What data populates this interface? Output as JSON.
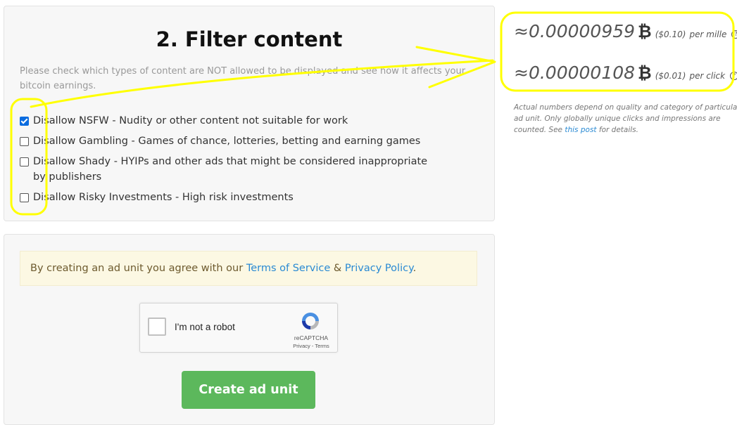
{
  "filter": {
    "title": "2. Filter content",
    "description": "Please check which types of content are NOT allowed to be displayed and see how it affects your bitcoin earnings.",
    "options": [
      {
        "label": "Disallow NSFW - Nudity or other content not suitable for work",
        "checked": true
      },
      {
        "label": "Disallow Gambling - Games of chance, lotteries, betting and earning games",
        "checked": false
      },
      {
        "label": "Disallow Shady - HYIPs and other ads that might be considered inappropriate by publishers",
        "checked": false
      },
      {
        "label": "Disallow Risky Investments - High risk investments",
        "checked": false
      }
    ]
  },
  "agreement": {
    "prefix": "By creating an ad unit you agree with our ",
    "terms_link": "Terms of Service",
    "amp": " & ",
    "privacy_link": "Privacy Policy",
    "suffix": "."
  },
  "recaptcha": {
    "label": "I'm not a robot",
    "brand": "reCAPTCHA",
    "links": "Privacy - Terms"
  },
  "create_button": "Create ad unit",
  "rates": {
    "per_mille": {
      "value": "≈0.00000959",
      "usd": "($0.10)",
      "unit": "per mille"
    },
    "per_click": {
      "value": "≈0.00000108",
      "usd": "($0.01)",
      "unit": "per click"
    },
    "btc_symbol": "₿",
    "help_glyph": "?"
  },
  "note": {
    "text": "Actual numbers depend on quality and category of particular ad unit. Only globally unique clicks and impressions are counted. See ",
    "link": "this post",
    "suffix": " for details."
  },
  "annotation_color": "#ffff00"
}
